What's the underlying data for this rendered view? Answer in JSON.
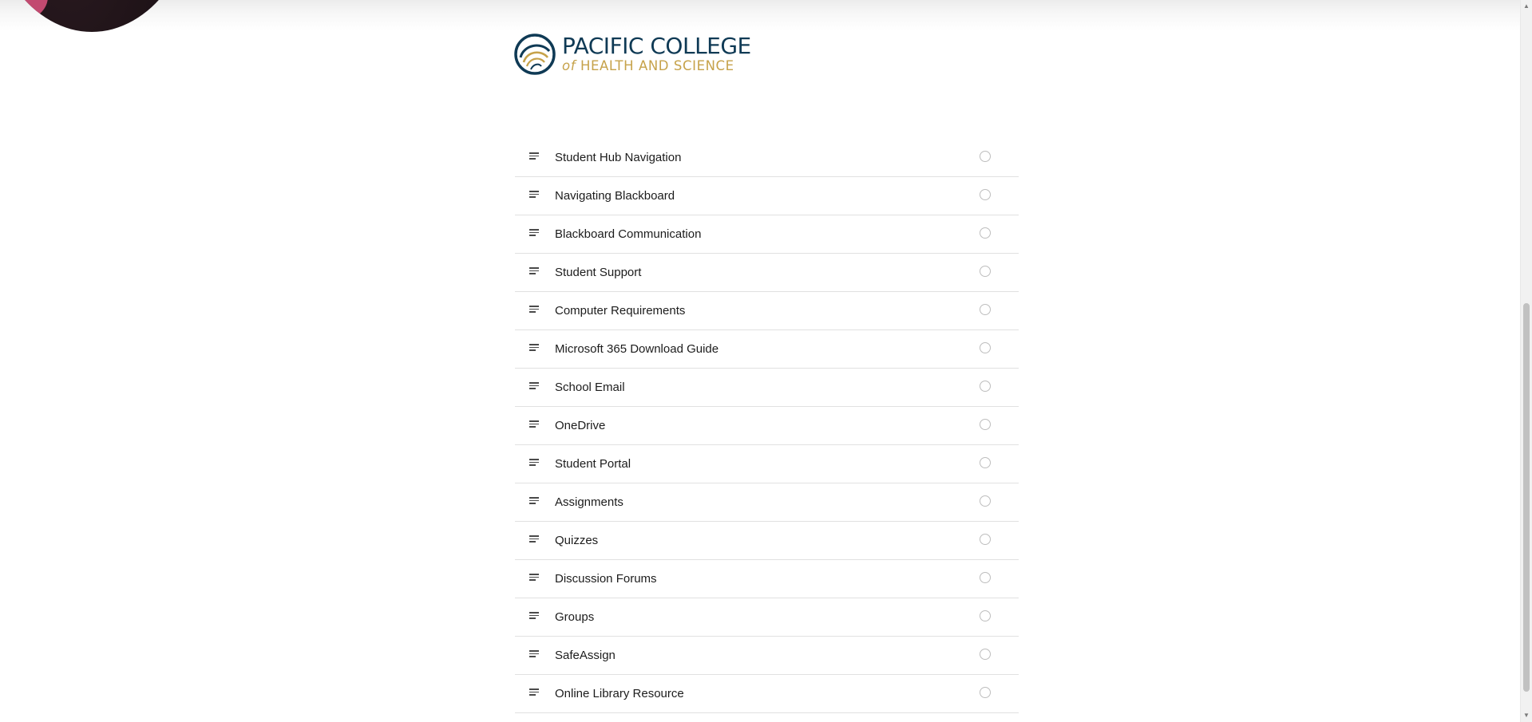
{
  "brand": {
    "name_line1": "PACIFIC COLLEGE",
    "name_line2_prefix": "of",
    "name_line2": "HEALTH AND SCIENCE",
    "primary_color": "#0f3a55",
    "accent_color": "#c6a24a"
  },
  "menu": {
    "items": [
      {
        "label": "Student Hub Navigation",
        "icon": "lines-icon",
        "completed": false
      },
      {
        "label": "Navigating Blackboard",
        "icon": "lines-icon",
        "completed": false
      },
      {
        "label": "Blackboard Communication",
        "icon": "lines-icon",
        "completed": false
      },
      {
        "label": "Student Support",
        "icon": "lines-icon",
        "completed": false
      },
      {
        "label": "Computer Requirements",
        "icon": "lines-icon",
        "completed": false
      },
      {
        "label": "Microsoft 365 Download Guide",
        "icon": "lines-icon",
        "completed": false
      },
      {
        "label": "School Email",
        "icon": "lines-icon",
        "completed": false
      },
      {
        "label": "OneDrive",
        "icon": "lines-icon",
        "completed": false
      },
      {
        "label": "Student Portal",
        "icon": "lines-icon",
        "completed": false
      },
      {
        "label": "Assignments",
        "icon": "lines-icon",
        "completed": false
      },
      {
        "label": "Quizzes",
        "icon": "lines-icon",
        "completed": false
      },
      {
        "label": "Discussion Forums",
        "icon": "lines-icon",
        "completed": false
      },
      {
        "label": "Groups",
        "icon": "lines-icon",
        "completed": false
      },
      {
        "label": "SafeAssign",
        "icon": "lines-icon",
        "completed": false
      },
      {
        "label": "Online Library Resource",
        "icon": "lines-icon",
        "completed": false
      }
    ]
  }
}
